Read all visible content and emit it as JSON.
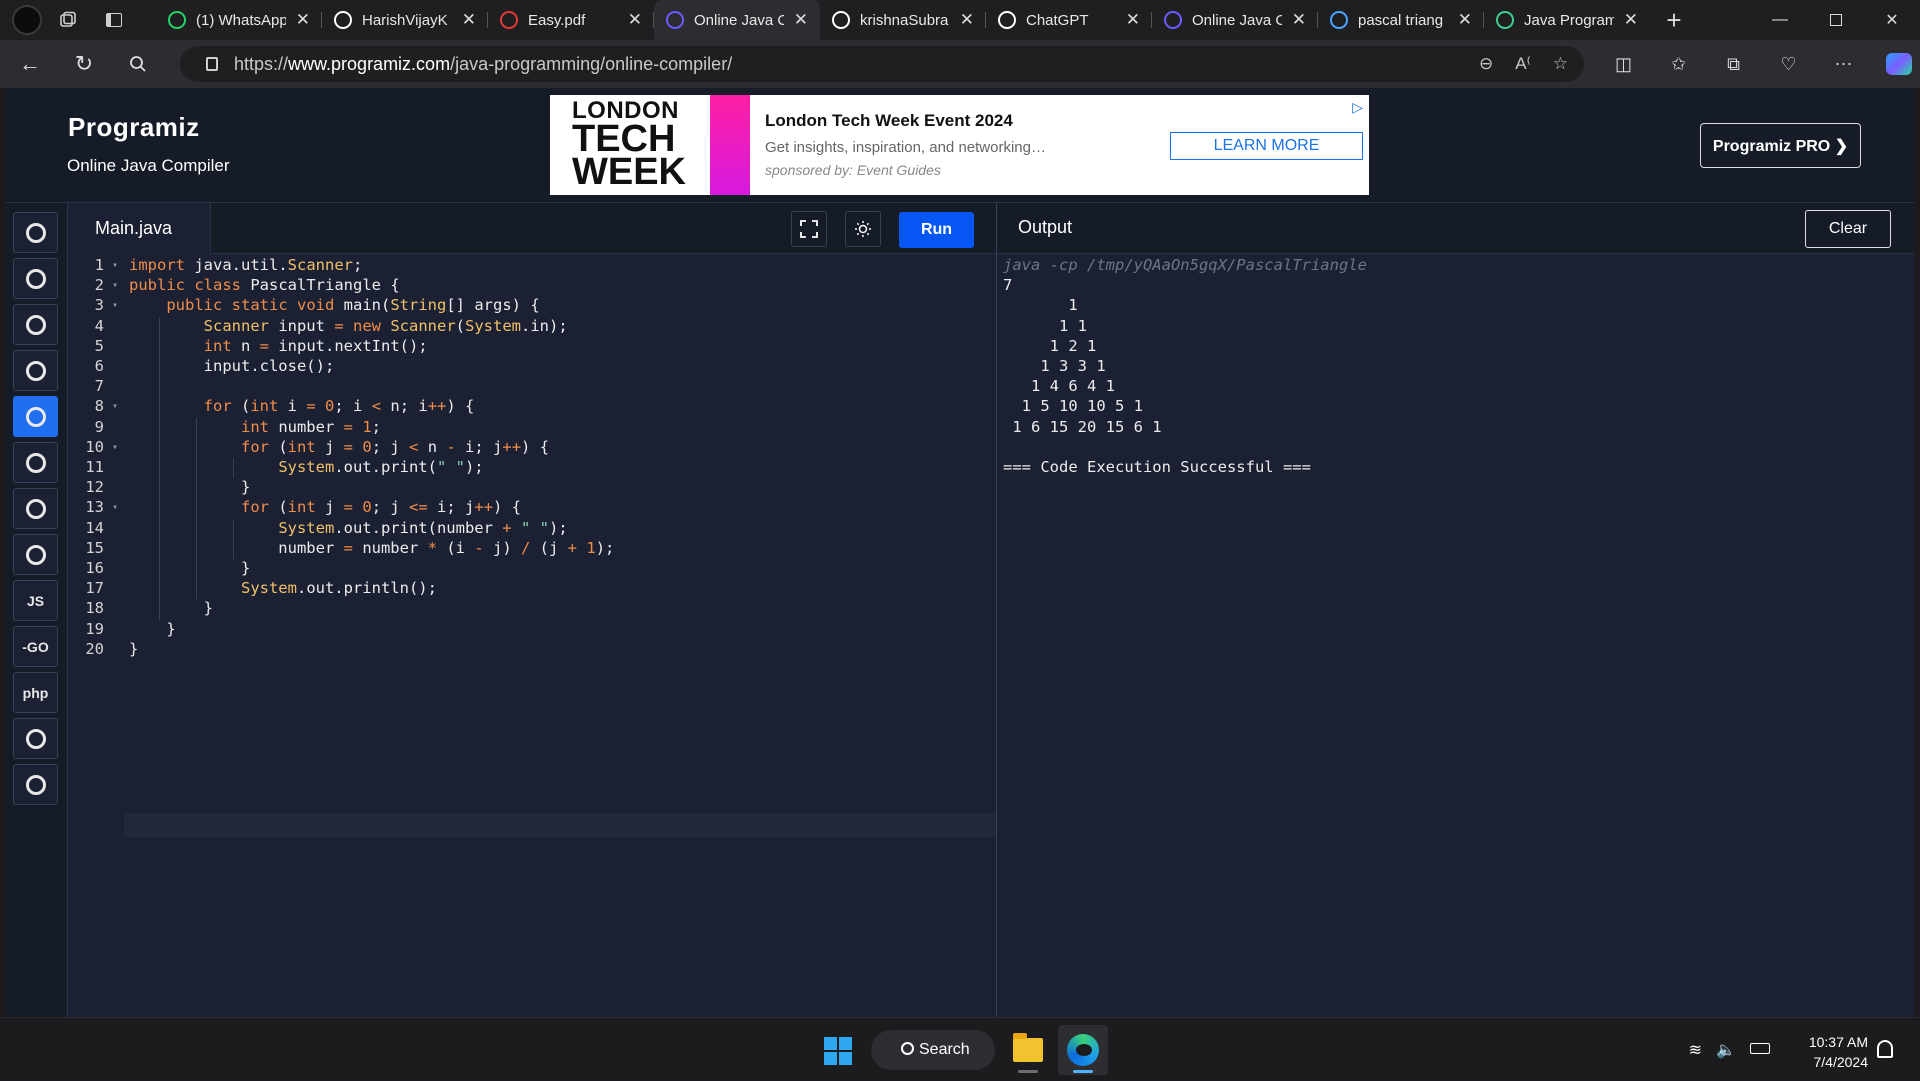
{
  "browser": {
    "tabs": [
      {
        "title": "(1) WhatsApp",
        "favicon": "whatsapp-icon",
        "color": "#25d366",
        "active": false
      },
      {
        "title": "HarishVijayK",
        "favicon": "github-icon",
        "color": "#ffffff",
        "active": false
      },
      {
        "title": "Easy.pdf",
        "favicon": "pdf-icon",
        "color": "#e53935",
        "active": false
      },
      {
        "title": "Online Java C",
        "favicon": "programiz-icon",
        "color": "#6b5cff",
        "active": true
      },
      {
        "title": "krishnaSubra",
        "favicon": "github-icon",
        "color": "#ffffff",
        "active": false
      },
      {
        "title": "ChatGPT",
        "favicon": "chatgpt-icon",
        "color": "#ffffff",
        "active": false
      },
      {
        "title": "Online Java C",
        "favicon": "programiz-icon",
        "color": "#6b5cff",
        "active": false
      },
      {
        "title": "pascal triang",
        "favicon": "search-icon",
        "color": "#4aa3ff",
        "active": false
      },
      {
        "title": "Java Program",
        "favicon": "link-icon",
        "color": "#3ecf8e",
        "active": false
      }
    ],
    "url_prefix": "https://",
    "url_host": "www.programiz.com",
    "url_path": "/java-programming/online-compiler/"
  },
  "page": {
    "logo": "Programiz",
    "subtitle": "Online Java Compiler",
    "ad": {
      "image_lines": [
        "LONDON",
        "TECH",
        "WEEK"
      ],
      "title": "London Tech Week Event 2024",
      "description": "Get insights, inspiration, and networking…",
      "sponsor": "sponsored by: Event Guides",
      "cta": "LEARN MORE"
    },
    "pro_button": "Programiz PRO ❯",
    "sidebar_languages": [
      {
        "name": "python-icon",
        "label": "",
        "active": false
      },
      {
        "name": "r-icon",
        "label": "",
        "active": false
      },
      {
        "name": "sql-icon",
        "label": "",
        "active": false
      },
      {
        "name": "html-icon",
        "label": "",
        "active": false
      },
      {
        "name": "java-icon",
        "label": "",
        "active": true
      },
      {
        "name": "c-icon",
        "label": "",
        "active": false
      },
      {
        "name": "cpp-icon",
        "label": "",
        "active": false
      },
      {
        "name": "csharp-icon",
        "label": "",
        "active": false
      },
      {
        "name": "javascript-icon",
        "label": "JS",
        "active": false
      },
      {
        "name": "go-icon",
        "label": "-GO",
        "active": false
      },
      {
        "name": "php-icon",
        "label": "php",
        "active": false
      },
      {
        "name": "swift-icon",
        "label": "",
        "active": false
      },
      {
        "name": "rust-icon",
        "label": "",
        "active": false
      }
    ],
    "file_tab": "Main.java",
    "run_button": "Run",
    "output_title": "Output",
    "clear_button": "Clear",
    "code_lines": [
      "import java.util.Scanner;",
      "public class PascalTriangle {",
      "    public static void main(String[] args) {",
      "        Scanner input = new Scanner(System.in);",
      "        int n = input.nextInt();",
      "        input.close();",
      "",
      "        for (int i = 0; i < n; i++) {",
      "            int number = 1;",
      "            for (int j = 0; j < n - i; j++) {",
      "                System.out.print(\" \");",
      "            }",
      "            for (int j = 0; j <= i; j++) {",
      "                System.out.print(number + \" \");",
      "                number = number * (i - j) / (j + 1);",
      "            }",
      "            System.out.println();",
      "        }",
      "    }",
      "}"
    ],
    "fold_lines": [
      1,
      2,
      3,
      8,
      10,
      13
    ],
    "output_lines": [
      "java -cp /tmp/yQAaOn5gqX/PascalTriangle",
      "7",
      "       1",
      "      1 1",
      "     1 2 1",
      "    1 3 3 1",
      "   1 4 6 4 1",
      "  1 5 10 10 5 1",
      " 1 6 15 20 15 6 1",
      "",
      "=== Code Execution Successful ==="
    ]
  },
  "taskbar": {
    "search_label": "Search",
    "time": "10:37 AM",
    "date": "7/4/2024"
  }
}
